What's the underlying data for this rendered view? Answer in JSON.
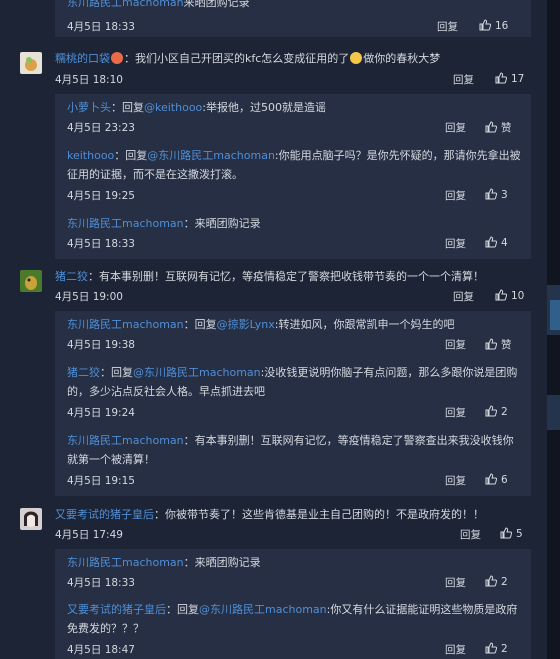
{
  "labels": {
    "reply": "回复",
    "reply_action": "回复"
  },
  "top_partial": {
    "user": "东川路民工machoman",
    "text": "来晒团购记录",
    "time": "4月5日 18:33",
    "likes": "16"
  },
  "comments": [
    {
      "user": "糯桃的口袋",
      "text_a": "：我们小区自己开团买的kfc怎么变成征用的了",
      "text_b": "做你的春秋大梦",
      "time": "4月5日 18:10",
      "likes": "17",
      "replies": [
        {
          "user": "小萝卜头",
          "target": "@keithooo",
          "text": ":举报他，过500就是造谣",
          "time": "4月5日 23:23",
          "likes": "赞"
        },
        {
          "user": "keithooo",
          "target": "@东川路民工machoman",
          "text": ":你能用点脑子吗？是你先怀疑的，那请你先拿出被征用的证据，而不是在这撒泼打滚。",
          "time": "4月5日 19:25",
          "likes": "3"
        },
        {
          "user": "东川路民工machoman",
          "target": "",
          "text": "：来晒团购记录",
          "time": "4月5日 18:33",
          "likes": "4"
        }
      ]
    },
    {
      "user": "猪二狡",
      "text_a": "：有本事别删！互联网有记忆，等疫情稳定了警察把收钱带节奏的一个一个清算！",
      "text_b": "",
      "time": "4月5日 19:00",
      "likes": "10",
      "replies": [
        {
          "user": "东川路民工machoman",
          "target": "@掠影Lynx",
          "text": ":转进如风，你跟常凯申一个妈生的吧",
          "time": "4月5日 19:38",
          "likes": "赞"
        },
        {
          "user": "猪二狡",
          "target": "@东川路民工machoman",
          "text": ":没收钱更说明你脑子有点问题，那么多跟你说是团购的，多少沾点反社会人格。早点抓进去吧",
          "time": "4月5日 19:24",
          "likes": "2"
        },
        {
          "user": "东川路民工machoman",
          "target": "",
          "text": "：有本事别删！互联网有记忆，等疫情稳定了警察查出来我没收钱你就第一个被清算！",
          "time": "4月5日 19:15",
          "likes": "6"
        }
      ]
    },
    {
      "user": "又要考试的猪子皇后",
      "text_a": "：你被带节奏了！这些肯德基是业主自己团购的！不是政府发的！！",
      "text_b": "",
      "time": "4月5日 17:49",
      "likes": "5",
      "replies": [
        {
          "user": "东川路民工machoman",
          "target": "",
          "text": "：来晒团购记录",
          "time": "4月5日 18:33",
          "likes": "2"
        },
        {
          "user": "又要考试的猪子皇后",
          "target": "@东川路民工machoman",
          "text": ":你又有什么证据能证明这些物质是政府免费发的？？？",
          "time": "4月5日 18:47",
          "likes": "2"
        }
      ]
    }
  ]
}
